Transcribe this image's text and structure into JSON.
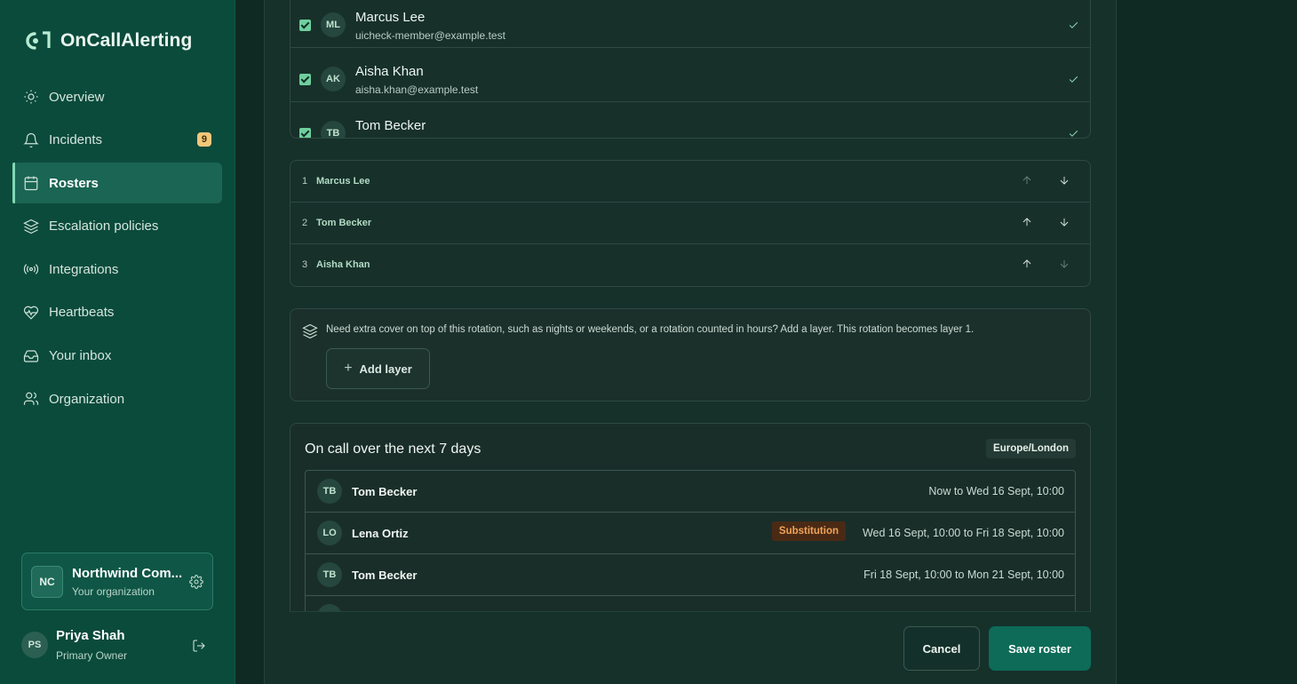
{
  "app": {
    "name": "OnCallAlerting"
  },
  "sidebar": {
    "items": [
      {
        "label": "Overview",
        "icon": "sun-icon"
      },
      {
        "label": "Incidents",
        "icon": "bell-icon",
        "badge": "9"
      },
      {
        "label": "Rosters",
        "icon": "calendar-icon",
        "active": true
      },
      {
        "label": "Escalation policies",
        "icon": "layers-icon"
      },
      {
        "label": "Integrations",
        "icon": "broadcast-icon"
      },
      {
        "label": "Heartbeats",
        "icon": "heart-pulse-icon"
      },
      {
        "label": "Your inbox",
        "icon": "inbox-icon"
      },
      {
        "label": "Organization",
        "icon": "users-icon"
      }
    ],
    "org": {
      "initials": "NC",
      "name": "Northwind Com...",
      "subtitle": "Your organization"
    },
    "user": {
      "initials": "PS",
      "name": "Priya Shah",
      "role": "Primary Owner"
    }
  },
  "members": [
    {
      "initials": "ML",
      "name": "Marcus Lee",
      "email": "uicheck-member@example.test",
      "checked": true
    },
    {
      "initials": "AK",
      "name": "Aisha Khan",
      "email": "aisha.khan@example.test",
      "checked": true
    },
    {
      "initials": "TB",
      "name": "Tom Becker",
      "email": "",
      "checked": true
    }
  ],
  "rotation_order": [
    {
      "index": "1",
      "name": "Marcus Lee"
    },
    {
      "index": "2",
      "name": "Tom Becker"
    },
    {
      "index": "3",
      "name": "Aisha Khan"
    }
  ],
  "layer": {
    "hint": "Need extra cover on top of this rotation, such as nights or weekends, or a rotation counted in hours? Add a layer. This rotation becomes layer 1.",
    "button_plus": "+",
    "button_label": "Add layer"
  },
  "oncall": {
    "title": "On call over the next 7 days",
    "timezone": "Europe/London",
    "rows": [
      {
        "initials": "TB",
        "name": "Tom Becker",
        "time": "Now to Wed 16 Sept, 10:00"
      },
      {
        "initials": "LO",
        "name": "Lena Ortiz",
        "badge": "Substitution",
        "time": "Wed 16 Sept, 10:00 to Fri 18 Sept, 10:00"
      },
      {
        "initials": "TB",
        "name": "Tom Becker",
        "time": "Fri 18 Sept, 10:00 to Mon 21 Sept, 10:00"
      }
    ]
  },
  "footer": {
    "cancel_label": "Cancel",
    "save_label": "Save roster"
  },
  "colors": {
    "sidebar_bg": "#0b4b3c",
    "accent": "#0d6b58",
    "badge": "#f1c77a",
    "substitution": "#f1a35a"
  }
}
